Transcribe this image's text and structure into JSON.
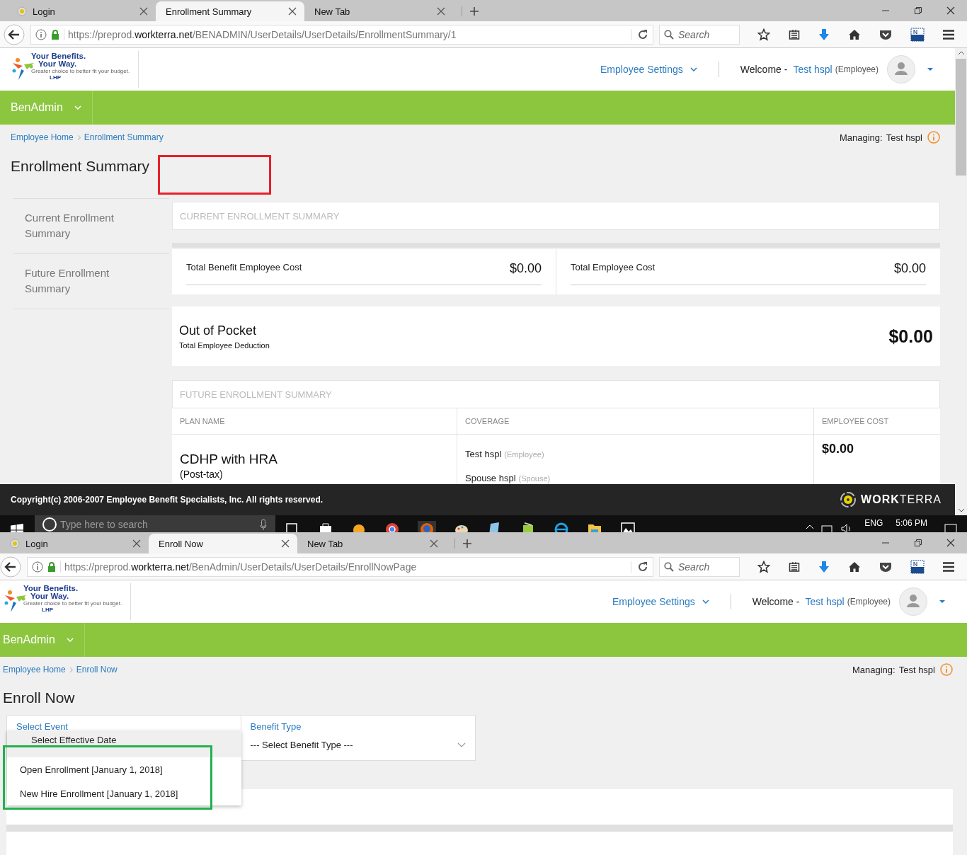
{
  "windows": [
    {
      "kind": "summary",
      "tabs": [
        {
          "label": "Login",
          "selected": false,
          "favicon": true
        },
        {
          "label": "Enrollment Summary",
          "selected": true,
          "favicon": false
        },
        {
          "label": "New Tab",
          "selected": false,
          "favicon": false
        }
      ],
      "url": {
        "scheme": "https://preprod.",
        "domain": "workterra.net",
        "path": "/BENADMIN/UserDetails/UserDetails/EnrollmentSummary/1"
      },
      "search_placeholder": "Search",
      "header": {
        "logo": {
          "line1": "Your Benefits.",
          "line2": "Your Way.",
          "tagline": "Greater choice to better fit your budget.",
          "mark": "LHP"
        },
        "settings": "Employee Settings",
        "welcome": "Welcome -",
        "user": "Test hspl",
        "role": "(Employee)"
      },
      "nav": "BenAdmin",
      "breadcrumb": [
        {
          "label": "Employee Home"
        },
        {
          "label": "Enrollment Summary"
        }
      ],
      "managing": {
        "label": "Managing:",
        "name": "Test hspl"
      },
      "title": "Enrollment Summary",
      "annotation": {
        "color": "#e8202a"
      },
      "sidebar": [
        {
          "label": "Current Enrollment Summary"
        },
        {
          "label": "Future Enrollment Summary"
        }
      ],
      "current": {
        "heading": "CURRENT ENROLLMENT SUMMARY",
        "costs": [
          {
            "label": "Total Benefit Employee Cost",
            "value": "$0.00"
          },
          {
            "label": "Total Employee Cost",
            "value": "$0.00"
          }
        ],
        "oop": {
          "title": "Out of Pocket",
          "subtitle": "Total Employee Deduction",
          "value": "$0.00"
        }
      },
      "future": {
        "heading": "FUTURE ENROLLMENT SUMMARY",
        "columns": [
          "PLAN NAME",
          "COVERAGE",
          "EMPLOYEE COST"
        ],
        "rows": [
          {
            "plan": "CDHP with HRA",
            "tax": "(Post-tax)",
            "coverage": [
              {
                "name": "Test hspl",
                "role": "(Employee)"
              },
              {
                "name": "Spouse hspl",
                "role": "(Spouse)"
              }
            ],
            "cost": "$0.00"
          }
        ]
      },
      "footer": {
        "copyright": "Copyright(c) 2006-2007 Employee Benefit Specialists, Inc. All rights reserved.",
        "brand": "**WORK**TERRA"
      }
    },
    {
      "kind": "taskbar",
      "search_placeholder": "Type here to search",
      "language": "ENG",
      "time": "5:06 PM"
    },
    {
      "kind": "enroll",
      "tabs": [
        {
          "label": "Login",
          "selected": false,
          "favicon": true
        },
        {
          "label": "Enroll Now",
          "selected": true,
          "favicon": false
        },
        {
          "label": "New Tab",
          "selected": false,
          "favicon": false
        }
      ],
      "url": {
        "scheme": "https://preprod.",
        "domain": "workterra.net",
        "path": "/BenAdmin/UserDetails/UserDetails/EnrollNowPage"
      },
      "search_placeholder": "Search",
      "header": {
        "logo": {
          "line1": "Your Benefits.",
          "line2": "Your Way.",
          "tagline": "Greater choice to better fit your budget.",
          "mark": "LHP"
        },
        "settings": "Employee Settings",
        "welcome": "Welcome -",
        "user": "Test hspl",
        "role": "(Employee)"
      },
      "nav": "BenAdmin",
      "breadcrumb": [
        {
          "label": "Employee Home"
        },
        {
          "label": "Enroll Now"
        }
      ],
      "managing": {
        "label": "Managing:",
        "name": "Test hspl"
      },
      "title": "Enroll Now",
      "select_event": {
        "label": "Select Event",
        "options": [
          {
            "label": "Select Effective Date",
            "selected": true
          },
          {
            "label": "Open Enrollment [January 1, 2018]",
            "selected": false
          },
          {
            "label": "New Hire Enrollment [January 1, 2018]",
            "selected": false
          }
        ]
      },
      "benefit_type": {
        "label": "Benefit Type",
        "value": "--- Select Benefit Type ---"
      },
      "annotation": {
        "color": "#22b14c"
      }
    }
  ]
}
